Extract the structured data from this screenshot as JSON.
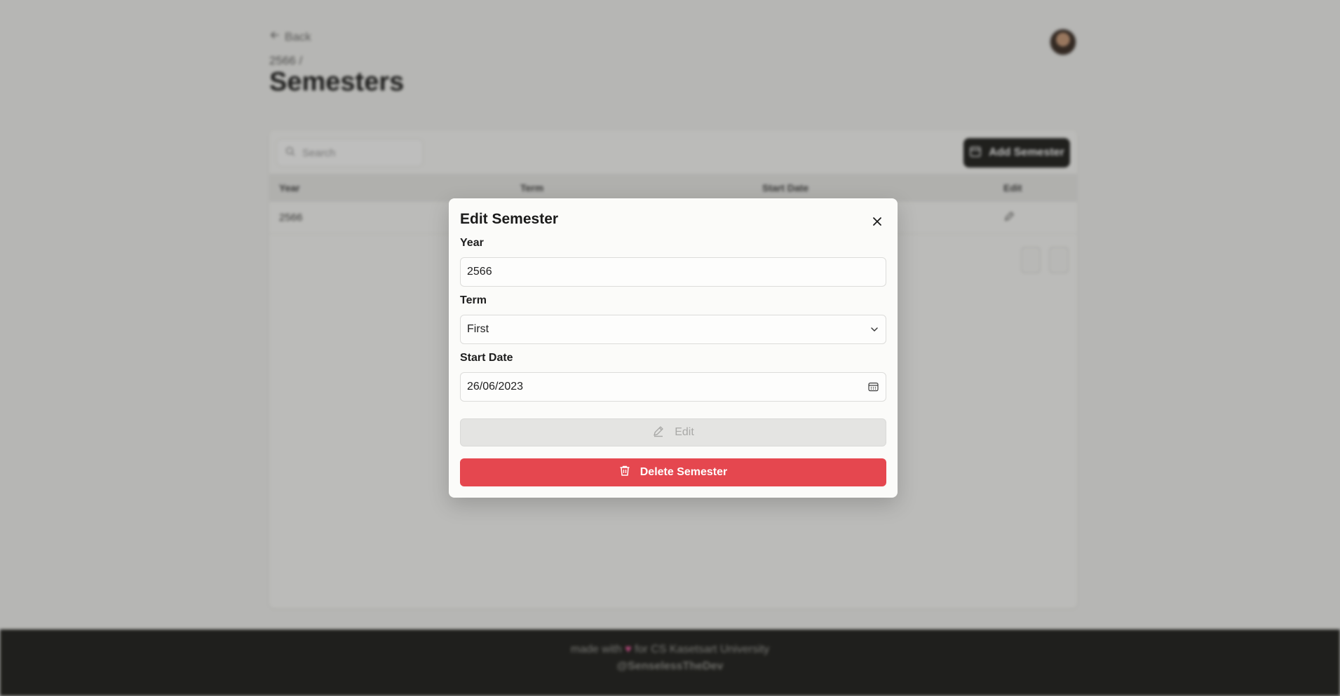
{
  "background": {
    "back_label": "Back",
    "breadcrumb": "2566 /",
    "page_title": "Semesters",
    "search_placeholder": "Search",
    "add_button_label": "Add Semester",
    "table": {
      "columns": [
        "Year",
        "Term",
        "Start Date",
        "Edit"
      ],
      "rows": [
        [
          "2566",
          "",
          "",
          ""
        ]
      ]
    },
    "footer": {
      "made_with_prefix": "made with",
      "made_with_suffix": "for CS Kasetsart University",
      "handle": "@SenselessTheDev"
    }
  },
  "modal": {
    "title": "Edit Semester",
    "year_label": "Year",
    "year_value": "2566",
    "term_label": "Term",
    "term_value": "First",
    "start_date_label": "Start Date",
    "start_date_value": "26/06/2023",
    "edit_button_label": "Edit",
    "delete_button_label": "Delete Semester"
  },
  "colors": {
    "delete": "#e5474f",
    "overlay": "rgba(40,40,38,0.30)",
    "footer_bg": "#1c1c1a"
  },
  "icons": {
    "back": "arrow-left-icon",
    "search": "search-icon",
    "add": "calendar-plus-icon",
    "edit_row": "pencil-icon",
    "close": "close-icon",
    "term_select": "chevron-down-icon",
    "date": "calendar-icon",
    "edit_button": "pencil-icon",
    "delete_button": "trash-icon",
    "heart": "heart-icon"
  }
}
